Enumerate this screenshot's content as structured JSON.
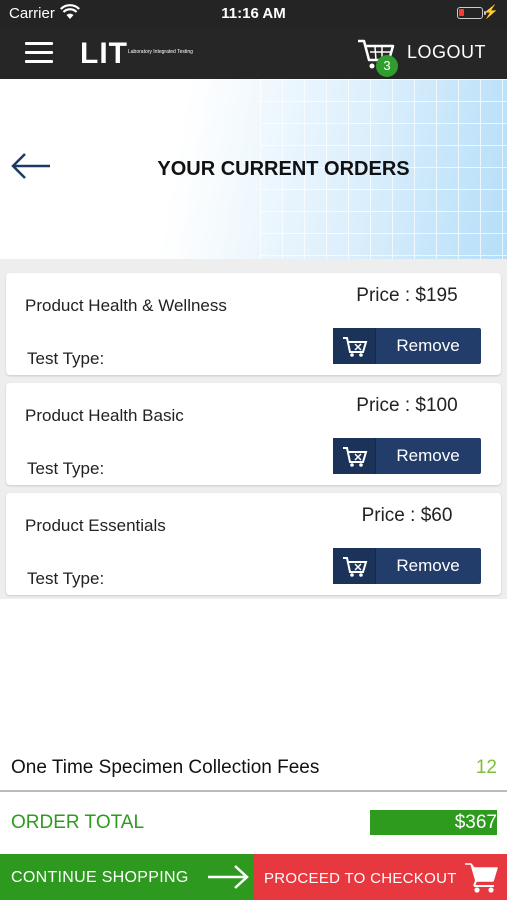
{
  "status_bar": {
    "carrier": "Carrier",
    "time": "11:16 AM"
  },
  "nav": {
    "logo_text": "LIT",
    "logo_subtitle": "Laboratory Integrated Testing",
    "cart_count": "3",
    "logout_label": "LOGOUT"
  },
  "header": {
    "title": "YOUR CURRENT ORDERS"
  },
  "orders": [
    {
      "name": "Product Health &  Wellness",
      "price": "Price : $195",
      "test_type": "Test Type:",
      "remove_label": "Remove"
    },
    {
      "name": "Product Health Basic",
      "price": "Price : $100",
      "test_type": "Test Type:",
      "remove_label": "Remove"
    },
    {
      "name": "Product Essentials",
      "price": "Price : $60",
      "test_type": "Test Type:",
      "remove_label": "Remove"
    }
  ],
  "fees": {
    "label": "One Time Specimen Collection Fees",
    "value": "12"
  },
  "total": {
    "label": "ORDER TOTAL",
    "value": "$367"
  },
  "actions": {
    "continue_label": "CONTINUE SHOPPING",
    "checkout_label": "PROCEED TO CHECKOUT"
  },
  "colors": {
    "nav_bg": "#262626",
    "green": "#2e9b1f",
    "red": "#e7373f",
    "navy": "#223d69"
  }
}
